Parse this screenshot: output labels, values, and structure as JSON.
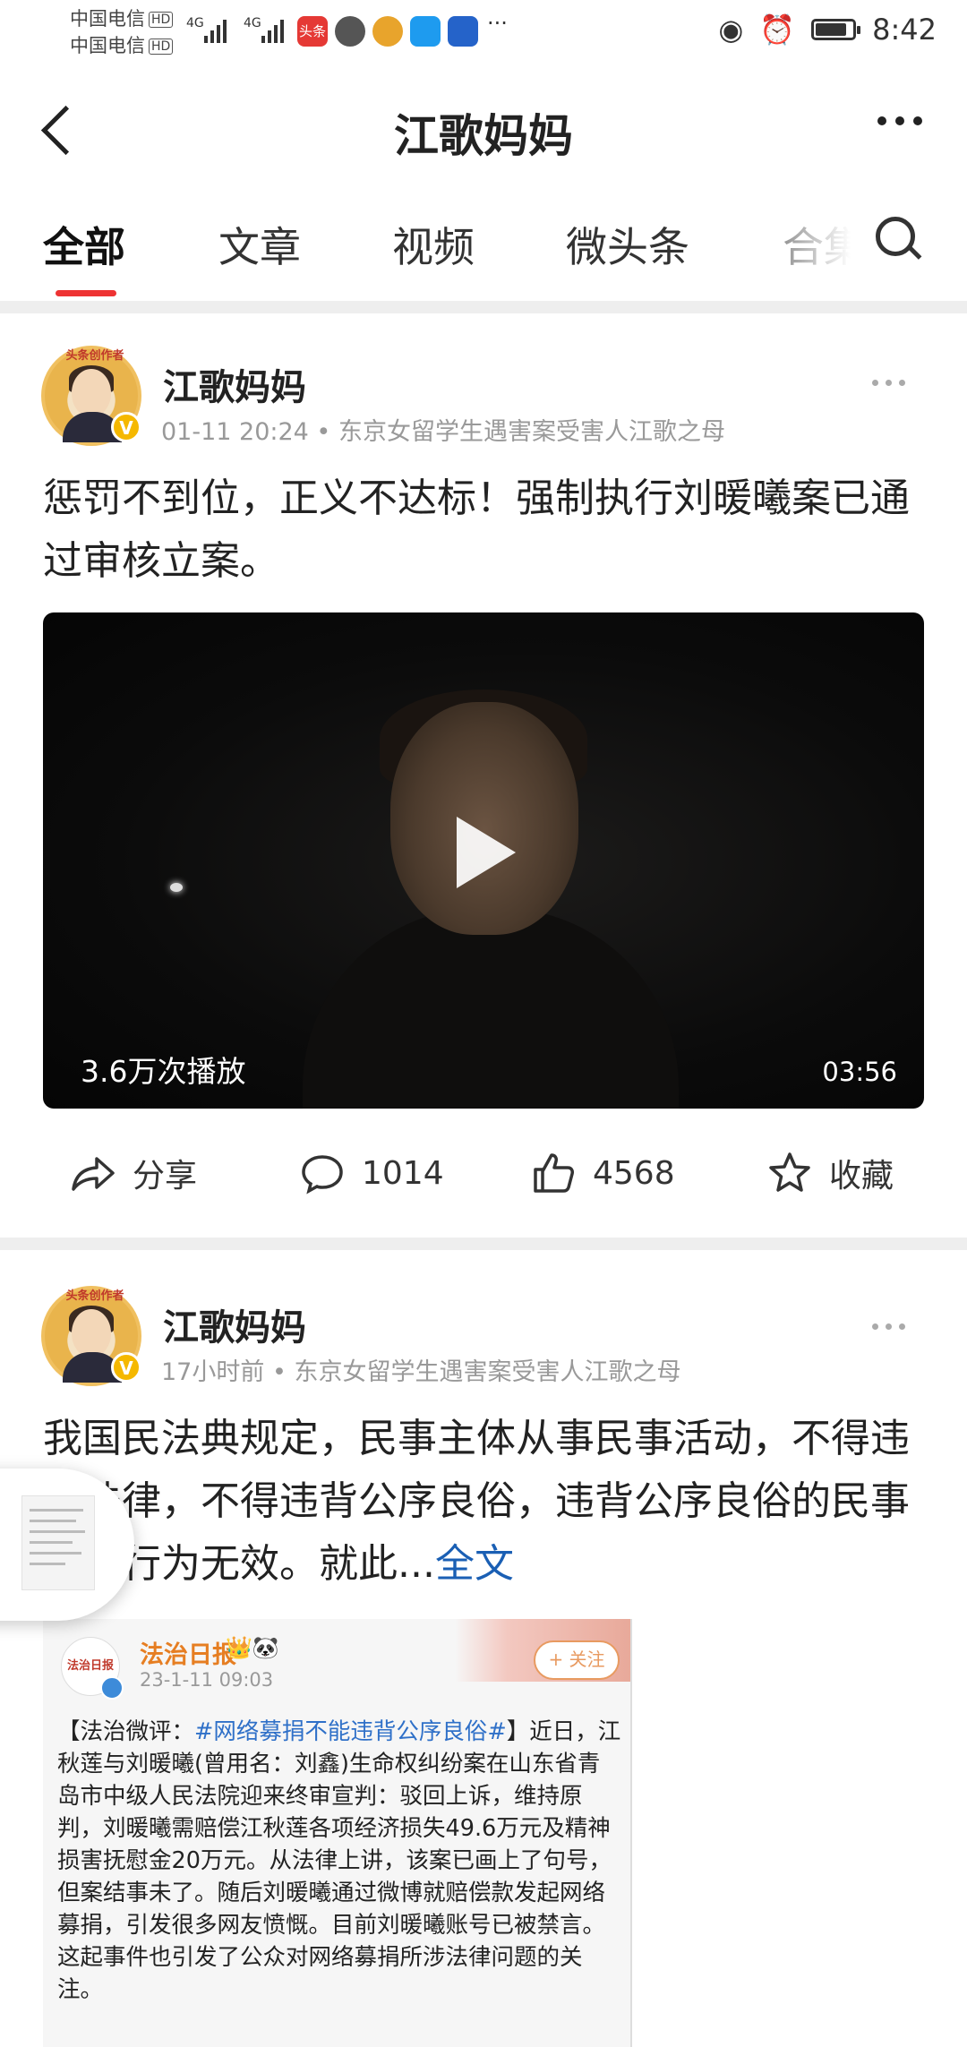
{
  "status_bar": {
    "carrier1": "中国电信",
    "carrier2": "中国电信",
    "hd": "HD",
    "net1": "4G",
    "net2": "4G",
    "toutiao_icon_label": "头条",
    "overflow": "···",
    "time": "8:42",
    "battery_level": 0.85
  },
  "header": {
    "title": "江歌妈妈"
  },
  "tabs": [
    "全部",
    "文章",
    "视频",
    "微头条",
    "合集"
  ],
  "post1": {
    "author": "江歌妈妈",
    "avatar_badge": "头条创作者",
    "meta": "01-11 20:24 • 东京女留学生遇害案受害人江歌之母",
    "text": "惩罚不到位，正义不达标！强制执行刘暖曦案已通过审核立案。",
    "video": {
      "plays": "3.6万次播放",
      "duration": "03:56"
    },
    "actions": {
      "share": "分享",
      "comments": "1014",
      "likes": "4568",
      "collect": "收藏"
    }
  },
  "post2": {
    "author": "江歌妈妈",
    "avatar_badge": "头条创作者",
    "meta": "17小时前 • 东京女留学生遇害案受害人江歌之母",
    "text": "我国民法典规定，民事主体从事民事活动，不得违反法律，不得违背公序良俗，违背公序良俗的民事法律行为无效。就此...",
    "full_text_link": "全文",
    "quote": {
      "logo_text": "法治日报",
      "name": "法治日报",
      "icons": "👑🐼",
      "date": "23-1-11 09:03",
      "follow": "+ 关注",
      "text_prefix": "【法治微评：",
      "hashtag": "#网络募捐不能违背公序良俗#",
      "text_body": "】近日，江秋莲与刘暖曦(曾用名：刘鑫)生命权纠纷案在山东省青岛市中级人民法院迎来终审宣判：驳回上诉，维持原判，刘暖曦需赔偿江秋莲各项经济损失49.6万元及精神损害抚慰金20万元。从法律上讲，该案已画上了句号，但案结事未了。随后刘暖曦通过微博就赔偿款发起网络募捐，引发很多网友愤慨。目前刘暖曦账号已被禁言。这起事件也引发了公众对网络募捐所涉法律问题的关注。"
    }
  },
  "icons": {
    "back": "back-arrow-icon",
    "more": "more-dots-icon",
    "search": "search-icon",
    "share": "share-icon",
    "comment": "comment-icon",
    "like": "thumbs-up-icon",
    "collect": "star-icon",
    "play": "play-icon",
    "verified": "verified-v-icon"
  },
  "colors": {
    "tab_underline": "#e33333",
    "link": "#1a5fb4",
    "hashtag": "#2f70c8",
    "verified_badge": "#f5b800",
    "quote_name": "#e67e22"
  }
}
